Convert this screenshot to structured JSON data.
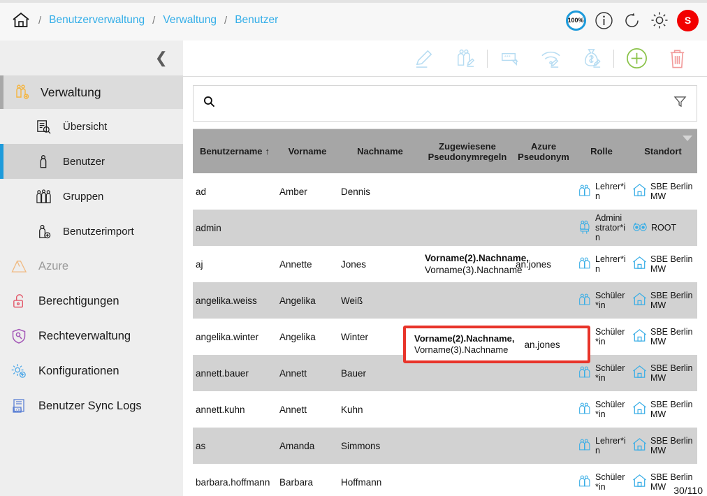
{
  "topbar": {
    "home_icon": "home-icon",
    "separator": "/",
    "breadcrumb": [
      {
        "label": "Benutzerverwaltung"
      },
      {
        "label": "Verwaltung"
      },
      {
        "label": "Benutzer"
      }
    ],
    "zoom_badge": "100%",
    "info_icon": "info-icon",
    "refresh_icon": "refresh-icon",
    "settings_icon": "gear-icon",
    "avatar_initial": "S",
    "accent_blue": "#34aee8",
    "avatar_color": "#f20000"
  },
  "sidebar": {
    "collapse_icon": "chevron-left-icon",
    "section": {
      "label": "Verwaltung",
      "icon": "users-gear-icon"
    },
    "sub_items": [
      {
        "label": "Übersicht",
        "icon": "document-search-icon",
        "active": false
      },
      {
        "label": "Benutzer",
        "icon": "person-icon",
        "active": true
      },
      {
        "label": "Gruppen",
        "icon": "people-group-icon",
        "active": false
      },
      {
        "label": "Benutzerimport",
        "icon": "person-import-icon",
        "active": false
      }
    ],
    "main_items": [
      {
        "label": "Azure",
        "icon": "azure-icon",
        "disabled": true
      },
      {
        "label": "Berechtigungen",
        "icon": "lock-open-icon",
        "disabled": false
      },
      {
        "label": "Rechteverwaltung",
        "icon": "shield-key-icon",
        "disabled": false
      },
      {
        "label": "Konfigurationen",
        "icon": "gear-config-icon",
        "disabled": false
      },
      {
        "label": "Benutzer Sync Logs",
        "icon": "log-document-icon",
        "disabled": false
      }
    ]
  },
  "toolbar": {
    "buttons": [
      {
        "name": "edit-user-button",
        "icon": "pencil-icon"
      },
      {
        "name": "edit-group-button",
        "icon": "people-edit-icon"
      },
      {
        "name": "edit-password-button",
        "icon": "password-edit-icon"
      },
      {
        "name": "edit-wifi-button",
        "icon": "wifi-edit-icon"
      },
      {
        "name": "edit-budget-button",
        "icon": "money-bag-edit-icon"
      },
      {
        "name": "add-user-button",
        "icon": "plus-circle-icon"
      },
      {
        "name": "delete-user-button",
        "icon": "trash-icon"
      }
    ]
  },
  "search": {
    "icon": "search-icon",
    "value": "",
    "placeholder": "",
    "filter_icon": "filter-funnel-icon"
  },
  "table": {
    "columns": [
      {
        "label": "Benutzername",
        "sort": "↑"
      },
      {
        "label": "Vorname",
        "sort": ""
      },
      {
        "label": "Nachname",
        "sort": ""
      },
      {
        "label": "Zugewiesene Pseudonymregeln",
        "sort": ""
      },
      {
        "label": "Azure Pseudonym",
        "sort": ""
      },
      {
        "label": "Rolle",
        "sort": ""
      },
      {
        "label": "Standort",
        "sort": ""
      }
    ],
    "rows": [
      {
        "username": "ad",
        "vorname": "Amber",
        "nachname": "Dennis",
        "rules": "",
        "rules_bold": "",
        "azure": "",
        "role": "Lehrer*in",
        "role_icon": "two-people-icon",
        "location": "SBE Berlin MW",
        "location_icon": "house-icon"
      },
      {
        "username": "admin",
        "vorname": "",
        "nachname": "",
        "rules": "",
        "rules_bold": "",
        "azure": "",
        "role": "Administrator*in",
        "role_icon": "person-podium-icon",
        "location": "ROOT",
        "location_icon": "owl-icon"
      },
      {
        "username": "aj",
        "vorname": "Annette",
        "nachname": "Jones",
        "rules_bold": "Vorname(2).Nachname,",
        "rules": "Vorname(3).Nachname",
        "azure": "an.jones",
        "role": "Lehrer*in",
        "role_icon": "two-people-icon",
        "location": "SBE Berlin MW",
        "location_icon": "house-icon"
      },
      {
        "username": "angelika.weiss",
        "vorname": "Angelika",
        "nachname": "Weiß",
        "rules": "",
        "rules_bold": "",
        "azure": "",
        "role": "Schüler*in",
        "role_icon": "two-people-icon",
        "location": "SBE Berlin MW",
        "location_icon": "house-icon"
      },
      {
        "username": "angelika.winter",
        "vorname": "Angelika",
        "nachname": "Winter",
        "rules": "",
        "rules_bold": "",
        "azure": "",
        "role": "Schüler*in",
        "role_icon": "two-people-icon",
        "location": "SBE Berlin MW",
        "location_icon": "house-icon"
      },
      {
        "username": "annett.bauer",
        "vorname": "Annett",
        "nachname": "Bauer",
        "rules": "",
        "rules_bold": "",
        "azure": "",
        "role": "Schüler*in",
        "role_icon": "two-people-icon",
        "location": "SBE Berlin MW",
        "location_icon": "house-icon"
      },
      {
        "username": "annett.kuhn",
        "vorname": "Annett",
        "nachname": "Kuhn",
        "rules": "",
        "rules_bold": "",
        "azure": "",
        "role": "Schüler*in",
        "role_icon": "two-people-icon",
        "location": "SBE Berlin MW",
        "location_icon": "house-icon"
      },
      {
        "username": "as",
        "vorname": "Amanda",
        "nachname": "Simmons",
        "rules": "",
        "rules_bold": "",
        "azure": "",
        "role": "Lehrer*in",
        "role_icon": "two-people-icon",
        "location": "SBE Berlin MW",
        "location_icon": "house-icon"
      },
      {
        "username": "barbara.hoffmann",
        "vorname": "Barbara",
        "nachname": "Hoffmann",
        "rules": "",
        "rules_bold": "",
        "azure": "",
        "role": "Schüler*in",
        "role_icon": "two-people-icon",
        "location": "SBE Berlin MW",
        "location_icon": "house-icon"
      }
    ],
    "counter": "30/110"
  },
  "highlight": {
    "rules_bold": "Vorname(2).Nachname,",
    "rules": "Vorname(3).Nachname",
    "azure": "an.jones",
    "border_color": "#e8342a"
  }
}
